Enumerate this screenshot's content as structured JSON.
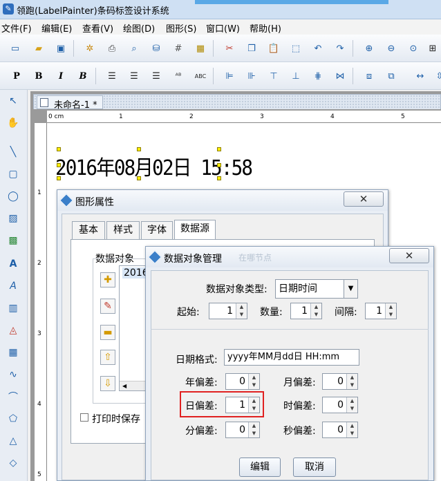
{
  "window": {
    "title": "领跑(LabelPainter)条码标签设计系统"
  },
  "menu": [
    "文件(F)",
    "编辑(E)",
    "查看(V)",
    "绘图(D)",
    "图形(S)",
    "窗口(W)",
    "帮助(H)"
  ],
  "toolbar1_icons": [
    "new-icon",
    "open-icon",
    "save-icon",
    "settings-icon",
    "print-icon",
    "print-preview-icon",
    "database-icon",
    "grid-icon",
    "calculator-icon",
    "cut-icon",
    "copy-icon",
    "paste-icon",
    "select-icon",
    "undo-icon",
    "redo-icon",
    "zoom-in-icon",
    "zoom-out-icon",
    "zoom-fit-icon",
    "fullscreen-icon"
  ],
  "toolbar2": {
    "bold_p": "P",
    "bold": "B",
    "italic": "I",
    "bold_italic": "B",
    "abc": "ABC"
  },
  "document": {
    "tab_label": "未命名-1 *",
    "ruler_unit": "0 cm",
    "h_ruler_marks": [
      "1",
      "2",
      "3",
      "4",
      "5"
    ],
    "v_ruler_marks": [
      "1",
      "2",
      "3",
      "4",
      "5"
    ],
    "canvas_text": "2016年08月02日 15:58"
  },
  "shape_properties": {
    "title": "图形属性",
    "tabs": [
      "基本",
      "样式",
      "字体",
      "数据源"
    ],
    "active_tab": "数据源",
    "data_object_label": "数据对象",
    "list_item": "2016",
    "print_save_label": "打印时保存"
  },
  "data_object_manager": {
    "title": "数据对象管理",
    "title_faded": "在哪节点",
    "type_label": "数据对象类型:",
    "type_value": "日期时间",
    "start_label": "起始:",
    "start_value": "1",
    "count_label": "数量:",
    "count_value": "1",
    "interval_label": "间隔:",
    "interval_value": "1",
    "format_label": "日期格式:",
    "format_value": "yyyy年MM月dd日 HH:mm",
    "year_offset_label": "年偏差:",
    "year_offset_value": "0",
    "month_offset_label": "月偏差:",
    "month_offset_value": "0",
    "day_offset_label": "日偏差:",
    "day_offset_value": "1",
    "hour_offset_label": "时偏差:",
    "hour_offset_value": "0",
    "minute_offset_label": "分偏差:",
    "minute_offset_value": "0",
    "second_offset_label": "秒偏差:",
    "second_offset_value": "0",
    "edit_button": "编辑",
    "cancel_button": "取消"
  }
}
